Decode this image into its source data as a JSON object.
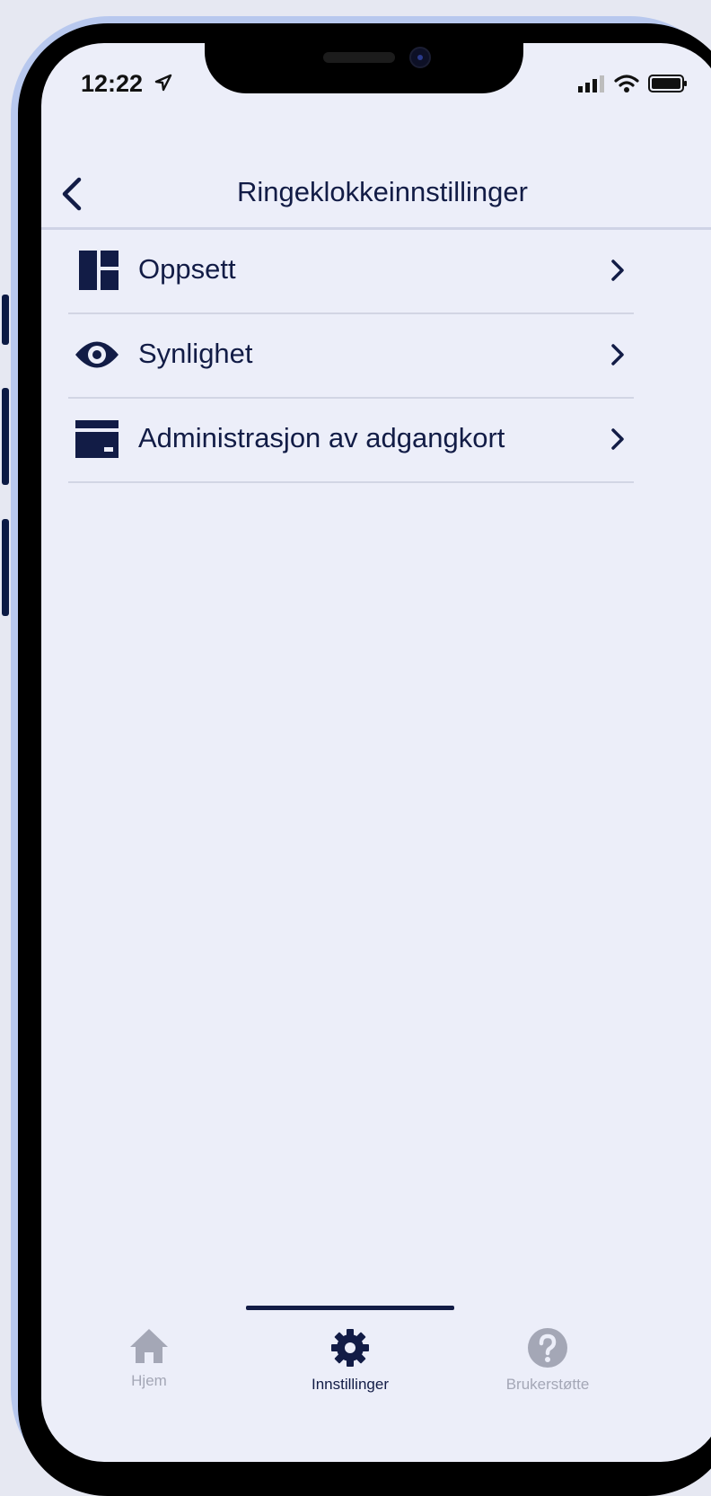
{
  "status_bar": {
    "time": "12:22",
    "location_icon": "location-arrow-icon",
    "signal_icon": "cellular-signal-icon",
    "wifi_icon": "wifi-icon",
    "battery_icon": "battery-icon"
  },
  "header": {
    "title": "Ringeklokkeinnstillinger",
    "back_icon": "chevron-left-icon"
  },
  "menu": {
    "items": [
      {
        "label": "Oppsett",
        "icon": "layout-grid-icon"
      },
      {
        "label": "Synlighet",
        "icon": "eye-icon"
      },
      {
        "label": "Administrasjon av adgangkort",
        "icon": "access-card-icon"
      }
    ]
  },
  "tab_bar": {
    "tabs": [
      {
        "label": "Hjem",
        "icon": "home-icon",
        "active": false
      },
      {
        "label": "Innstillinger",
        "icon": "gear-icon",
        "active": true
      },
      {
        "label": "Brukerstøtte",
        "icon": "help-circle-icon",
        "active": false
      }
    ]
  },
  "colors": {
    "primary": "#121c46",
    "screen_background": "#eceef9",
    "inactive_tab": "#a4a7b6",
    "divider": "#d2d5e4",
    "phone_frame": "#b8c8ee"
  }
}
